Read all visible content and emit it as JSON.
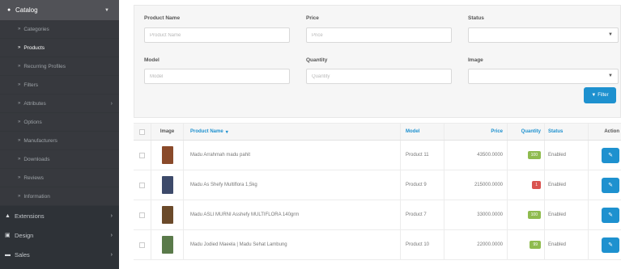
{
  "sidebar": {
    "catalog": {
      "label": "Catalog",
      "icon": "tags-icon"
    },
    "subitems": [
      {
        "label": "Categories",
        "active": false,
        "chevron": false
      },
      {
        "label": "Products",
        "active": true,
        "chevron": false
      },
      {
        "label": "Recurring Profiles",
        "active": false,
        "chevron": false
      },
      {
        "label": "Filters",
        "active": false,
        "chevron": false
      },
      {
        "label": "Attributes",
        "active": false,
        "chevron": true
      },
      {
        "label": "Options",
        "active": false,
        "chevron": false
      },
      {
        "label": "Manufacturers",
        "active": false,
        "chevron": false
      },
      {
        "label": "Downloads",
        "active": false,
        "chevron": false
      },
      {
        "label": "Reviews",
        "active": false,
        "chevron": false
      },
      {
        "label": "Information",
        "active": false,
        "chevron": false
      }
    ],
    "main_items": [
      {
        "label": "Extensions",
        "icon": "puzzle-icon"
      },
      {
        "label": "Design",
        "icon": "monitor-icon"
      },
      {
        "label": "Sales",
        "icon": "cart-icon"
      }
    ]
  },
  "filter": {
    "product_name_label": "Product Name",
    "product_name_placeholder": "Product Name",
    "price_label": "Price",
    "price_placeholder": "Price",
    "status_label": "Status",
    "model_label": "Model",
    "model_placeholder": "Model",
    "quantity_label": "Quantity",
    "quantity_placeholder": "Quantity",
    "image_label": "Image",
    "filter_button": "Filter"
  },
  "table": {
    "headers": {
      "image": "Image",
      "product_name": "Product Name",
      "model": "Model",
      "price": "Price",
      "quantity": "Quantity",
      "status": "Status",
      "action": "Action"
    },
    "rows": [
      {
        "name": "Madu Arrahmah madu pahit",
        "model": "Product 11",
        "price": "43500.0000",
        "quantity": "100",
        "qty_color": "#8fbb4f",
        "status": "Enabled",
        "thumb_color": "#8a4a2a"
      },
      {
        "name": "Madu As Shefy Multiflora 1,5kg",
        "model": "Product 9",
        "price": "215000.0000",
        "quantity": "1",
        "qty_color": "#d9534f",
        "status": "Enabled",
        "thumb_color": "#3d4a6a"
      },
      {
        "name": "Madu ASLI MURNI Asshefy MULTIFLORA 140grm",
        "model": "Product 7",
        "price": "33000.0000",
        "quantity": "100",
        "qty_color": "#8fbb4f",
        "status": "Enabled",
        "thumb_color": "#6b4a2a"
      },
      {
        "name": "Madu Jodied Maeela | Madu Sehat Lambung",
        "model": "Product 10",
        "price": "22000.0000",
        "quantity": "99",
        "qty_color": "#8fbb4f",
        "status": "Enabled",
        "thumb_color": "#5a7a4a"
      }
    ]
  },
  "colors": {
    "accent": "#1e91cf",
    "sidebar_bg": "#2e3237",
    "badge_success": "#8fbb4f",
    "badge_danger": "#d9534f"
  }
}
